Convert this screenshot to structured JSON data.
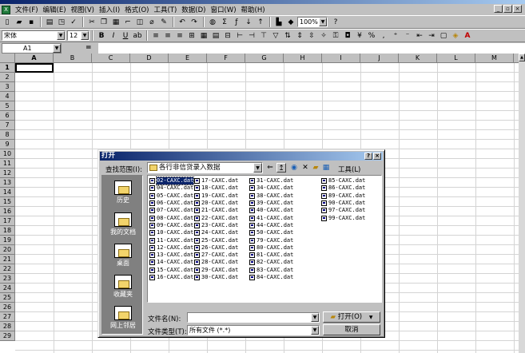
{
  "menu": [
    "文件(F)",
    "编辑(E)",
    "视图(V)",
    "插入(I)",
    "格式(O)",
    "工具(T)",
    "数据(D)",
    "窗口(W)",
    "帮助(H)"
  ],
  "toolbar1": {
    "zoom": "100%"
  },
  "toolbar2": {
    "font_name": "宋体",
    "font_size": "12"
  },
  "formula": {
    "name_box": "A1",
    "equals": "="
  },
  "columns": [
    "A",
    "B",
    "C",
    "D",
    "E",
    "F",
    "G",
    "H",
    "I",
    "J",
    "K",
    "L",
    "M"
  ],
  "rows": [
    "1",
    "2",
    "3",
    "4",
    "5",
    "6",
    "7",
    "8",
    "9",
    "10",
    "11",
    "12",
    "13",
    "14",
    "15",
    "16",
    "17",
    "18",
    "19",
    "20",
    "21",
    "22",
    "23",
    "24",
    "25",
    "26",
    "27",
    "28",
    "29"
  ],
  "dialog": {
    "title": "打开",
    "lookin_label": "查找范围(I):",
    "lookin_value": "各行非信贷录入数据",
    "tools_label": "工具(L)",
    "places": [
      "历史",
      "我的文档",
      "桌面",
      "收藏夹",
      "网上邻居"
    ],
    "file_columns": [
      [
        "02-CAXC.dat",
        "04-CAXC.dat",
        "05-CAXC.dat",
        "06-CAXC.dat",
        "07-CAXC.dat",
        "08-CAXC.dat",
        "09-CAXC.dat",
        "10-CAXC.dat",
        "11-CAXC.dat",
        "12-CAXC.dat",
        "13-CAXC.dat",
        "14-CAXC.dat",
        "15-CAXC.dat",
        "16-CAXC.dat"
      ],
      [
        "17-CAXC.dat",
        "18-CAXC.dat",
        "19-CAXC.dat",
        "20-CAXC.dat",
        "21-CAXC.dat",
        "22-CAXC.dat",
        "23-CAXC.dat",
        "24-CAXC.dat",
        "25-CAXC.dat",
        "26-CAXC.dat",
        "27-CAXC.dat",
        "28-CAXC.dat",
        "29-CAXC.dat",
        "30-CAXC.dat"
      ],
      [
        "31-CAXC.dat",
        "34-CAXC.dat",
        "38-CAXC.dat",
        "39-CAXC.dat",
        "40-CAXC.dat",
        "41-CAXC.dat",
        "44-CAXC.dat",
        "50-CAXC.dat",
        "79-CAXC.dat",
        "80-CAXC.dat",
        "81-CAXC.dat",
        "82-CAXC.dat",
        "83-CAXC.dat",
        "84-CAXC.dat"
      ],
      [
        "85-CAXC.dat",
        "86-CAXC.dat",
        "89-CAXC.dat",
        "90-CAXC.dat",
        "97-CAXC.dat",
        "99-CAXC.dat"
      ]
    ],
    "filename_label": "文件名(N):",
    "filename_value": "",
    "filetype_label": "文件类型(T):",
    "filetype_value": "所有文件 (*.*)",
    "open_label": "打开(O)",
    "cancel_label": "取消"
  }
}
